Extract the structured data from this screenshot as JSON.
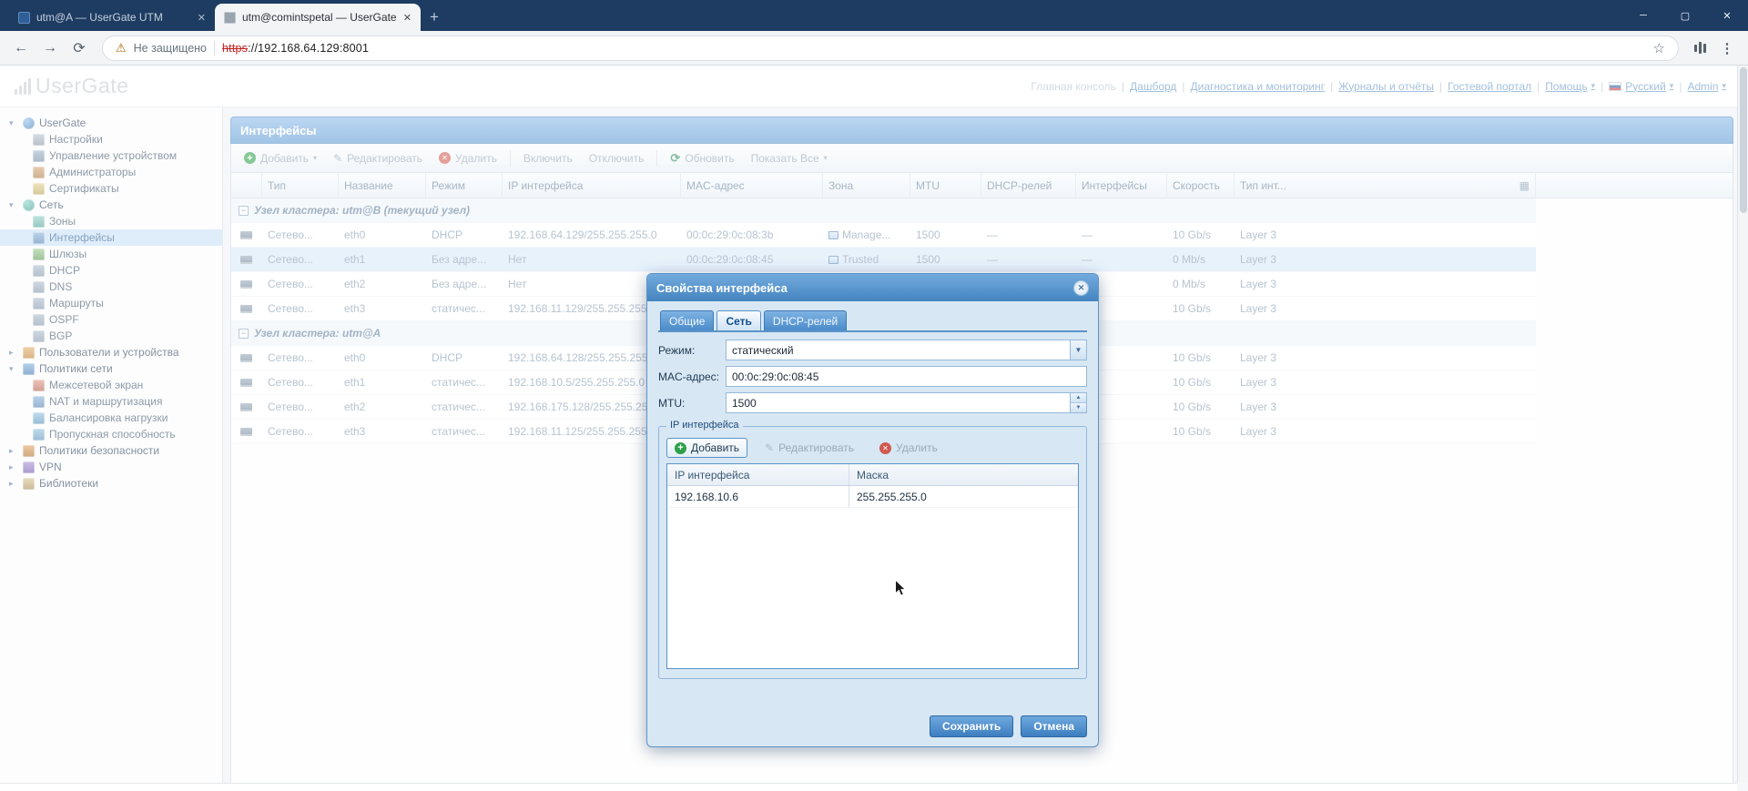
{
  "icons": {
    "dropdown": "▾",
    "expand_open": "▾",
    "expand_closed": "▸",
    "collapse": "−",
    "add": "+",
    "edit": "✎",
    "delete": "✕",
    "refresh": "⟳",
    "back": "←",
    "forward": "→",
    "reload": "⟳",
    "warning": "⚠",
    "star": "☆",
    "menu": "⋮",
    "new_tab": "+",
    "minimize": "─",
    "maximize": "▢",
    "close": "✕",
    "tab_close": "✕",
    "grid_options": "▦",
    "combo": "▼",
    "spin_up": "▲",
    "spin_down": "▼"
  },
  "browser": {
    "tabs": [
      {
        "title": "utm@A — UserGate UTM",
        "active": false
      },
      {
        "title": "utm@comintspetal — UserGate",
        "active": true
      }
    ],
    "nav": {
      "security_label": "Не защищено",
      "url_scheme": "https",
      "url_rest": "://192.168.64.129:8001"
    }
  },
  "header": {
    "logo_text": "UserGate",
    "links": [
      {
        "label": "Главная консоль",
        "muted": true
      },
      {
        "label": "Дашборд"
      },
      {
        "label": "Диагностика и мониторинг"
      },
      {
        "label": "Журналы и отчёты"
      },
      {
        "label": "Гостевой портал"
      },
      {
        "label": "Помощь",
        "dropdown": true
      },
      {
        "label": "Русский",
        "dropdown": true,
        "flag": true
      },
      {
        "label": "Admin",
        "dropdown": true
      }
    ]
  },
  "sidebar": {
    "tree": [
      {
        "label": "UserGate",
        "icon": "usergate",
        "expanded": true,
        "children": [
          {
            "label": "Настройки",
            "icon": "settings"
          },
          {
            "label": "Управление устройством",
            "icon": "device"
          },
          {
            "label": "Администраторы",
            "icon": "admins"
          },
          {
            "label": "Сертификаты",
            "icon": "certificates"
          }
        ]
      },
      {
        "label": "Сеть",
        "icon": "network",
        "expanded": true,
        "children": [
          {
            "label": "Зоны",
            "icon": "zones"
          },
          {
            "label": "Интерфейсы",
            "icon": "interfaces",
            "selected": true
          },
          {
            "label": "Шлюзы",
            "icon": "gateways"
          },
          {
            "label": "DHCP",
            "icon": "dhcp"
          },
          {
            "label": "DNS",
            "icon": "dns"
          },
          {
            "label": "Маршруты",
            "icon": "routes"
          },
          {
            "label": "OSPF",
            "icon": "ospf"
          },
          {
            "label": "BGP",
            "icon": "bgp"
          }
        ]
      },
      {
        "label": "Пользователи и устройства",
        "icon": "users",
        "expanded": false
      },
      {
        "label": "Политики сети",
        "icon": "net-policies",
        "expanded": true,
        "children": [
          {
            "label": "Межсетевой экран",
            "icon": "firewall"
          },
          {
            "label": "NAT и маршрутизация",
            "icon": "nat"
          },
          {
            "label": "Балансировка нагрузки",
            "icon": "load-balancing"
          },
          {
            "label": "Пропускная способность",
            "icon": "bandwidth"
          }
        ]
      },
      {
        "label": "Политики безопасности",
        "icon": "sec-policies",
        "expanded": false
      },
      {
        "label": "VPN",
        "icon": "vpn",
        "expanded": false
      },
      {
        "label": "Библиотеки",
        "icon": "libraries",
        "expanded": false
      }
    ]
  },
  "main": {
    "title": "Интерфейсы",
    "toolbar": [
      {
        "label": "Добавить",
        "icon": "add",
        "dropdown": true
      },
      {
        "label": "Редактировать",
        "icon": "edit"
      },
      {
        "label": "Удалить",
        "icon": "delete"
      },
      {
        "label": "Включить"
      },
      {
        "label": "Отключить"
      },
      {
        "label": "Обновить",
        "icon": "refresh"
      },
      {
        "label": "Показать Все",
        "dropdown": true
      }
    ],
    "table": {
      "columns": [
        "Тип",
        "Название",
        "Режим",
        "IP интерфейса",
        "MAC-адрес",
        "Зона",
        "MTU",
        "DHCP-релей",
        "Интерфейсы",
        "Скорость",
        "Тип инт..."
      ],
      "groups": [
        {
          "label": "Узел кластера: utm@B (текущий узел)",
          "rows": [
            {
              "cells": [
                "Сетево...",
                "eth0",
                "DHCP",
                "192.168.64.129/255.255.255.0",
                "00:0c:29:0c:08:3b",
                "Manage...",
                "1500",
                "—",
                "—",
                "10 Gb/s",
                "Layer 3"
              ],
              "zone_icon": true
            },
            {
              "cells": [
                "Сетево...",
                "eth1",
                "Без адре...",
                "Нет",
                "00:0c:29:0c:08:45",
                "Trusted",
                "1500",
                "—",
                "—",
                "0 Mb/s",
                "Layer 3"
              ],
              "zone_icon": true,
              "selected": true
            },
            {
              "cells": [
                "Сетево...",
                "eth2",
                "Без адре...",
                "Нет",
                "",
                "",
                "",
                "",
                "",
                "0 Mb/s",
                "Layer 3"
              ]
            },
            {
              "cells": [
                "Сетево...",
                "eth3",
                "статичес...",
                "192.168.11.129/255.255.255.0",
                "",
                "",
                "",
                "",
                "",
                "10 Gb/s",
                "Layer 3"
              ]
            }
          ]
        },
        {
          "label": "Узел кластера: utm@A",
          "rows": [
            {
              "cells": [
                "Сетево...",
                "eth0",
                "DHCP",
                "192.168.64.128/255.255.255.0",
                "",
                "",
                "",
                "",
                "",
                "10 Gb/s",
                "Layer 3"
              ]
            },
            {
              "cells": [
                "Сетево...",
                "eth1",
                "статичес...",
                "192.168.10.5/255.255.255.0",
                "",
                "",
                "",
                "",
                "",
                "10 Gb/s",
                "Layer 3"
              ]
            },
            {
              "cells": [
                "Сетево...",
                "eth2",
                "статичес...",
                "192.168.175.128/255.255.255.0",
                "",
                "",
                "",
                "",
                "",
                "10 Gb/s",
                "Layer 3"
              ]
            },
            {
              "cells": [
                "Сетево...",
                "eth3",
                "статичес...",
                "192.168.11.125/255.255.255.0",
                "",
                "",
                "",
                "",
                "",
                "10 Gb/s",
                "Layer 3"
              ]
            }
          ]
        }
      ]
    }
  },
  "dialog": {
    "title": "Свойства интерфейса",
    "tabs": [
      {
        "label": "Общие"
      },
      {
        "label": "Сеть",
        "active": true
      },
      {
        "label": "DHCP-релей"
      }
    ],
    "fields": [
      {
        "label": "Режим:",
        "value": "статический",
        "type": "combo"
      },
      {
        "label": "MAC-адрес:",
        "value": "00:0c:29:0c:08:45",
        "type": "text"
      },
      {
        "label": "MTU:",
        "value": "1500",
        "type": "spinner"
      }
    ],
    "fieldset": {
      "legend": "IP интерфейса",
      "toolbar": [
        {
          "label": "Добавить",
          "icon": "add",
          "focused": true
        },
        {
          "label": "Редактировать",
          "icon": "edit",
          "disabled": true
        },
        {
          "label": "Удалить",
          "icon": "delete",
          "disabled": true
        }
      ],
      "columns": [
        "IP интерфейса",
        "Маска"
      ],
      "rows": [
        [
          "192.168.10.6",
          "255.255.255.0"
        ]
      ]
    },
    "buttons": [
      {
        "label": "Сохранить"
      },
      {
        "label": "Отмена"
      }
    ]
  }
}
